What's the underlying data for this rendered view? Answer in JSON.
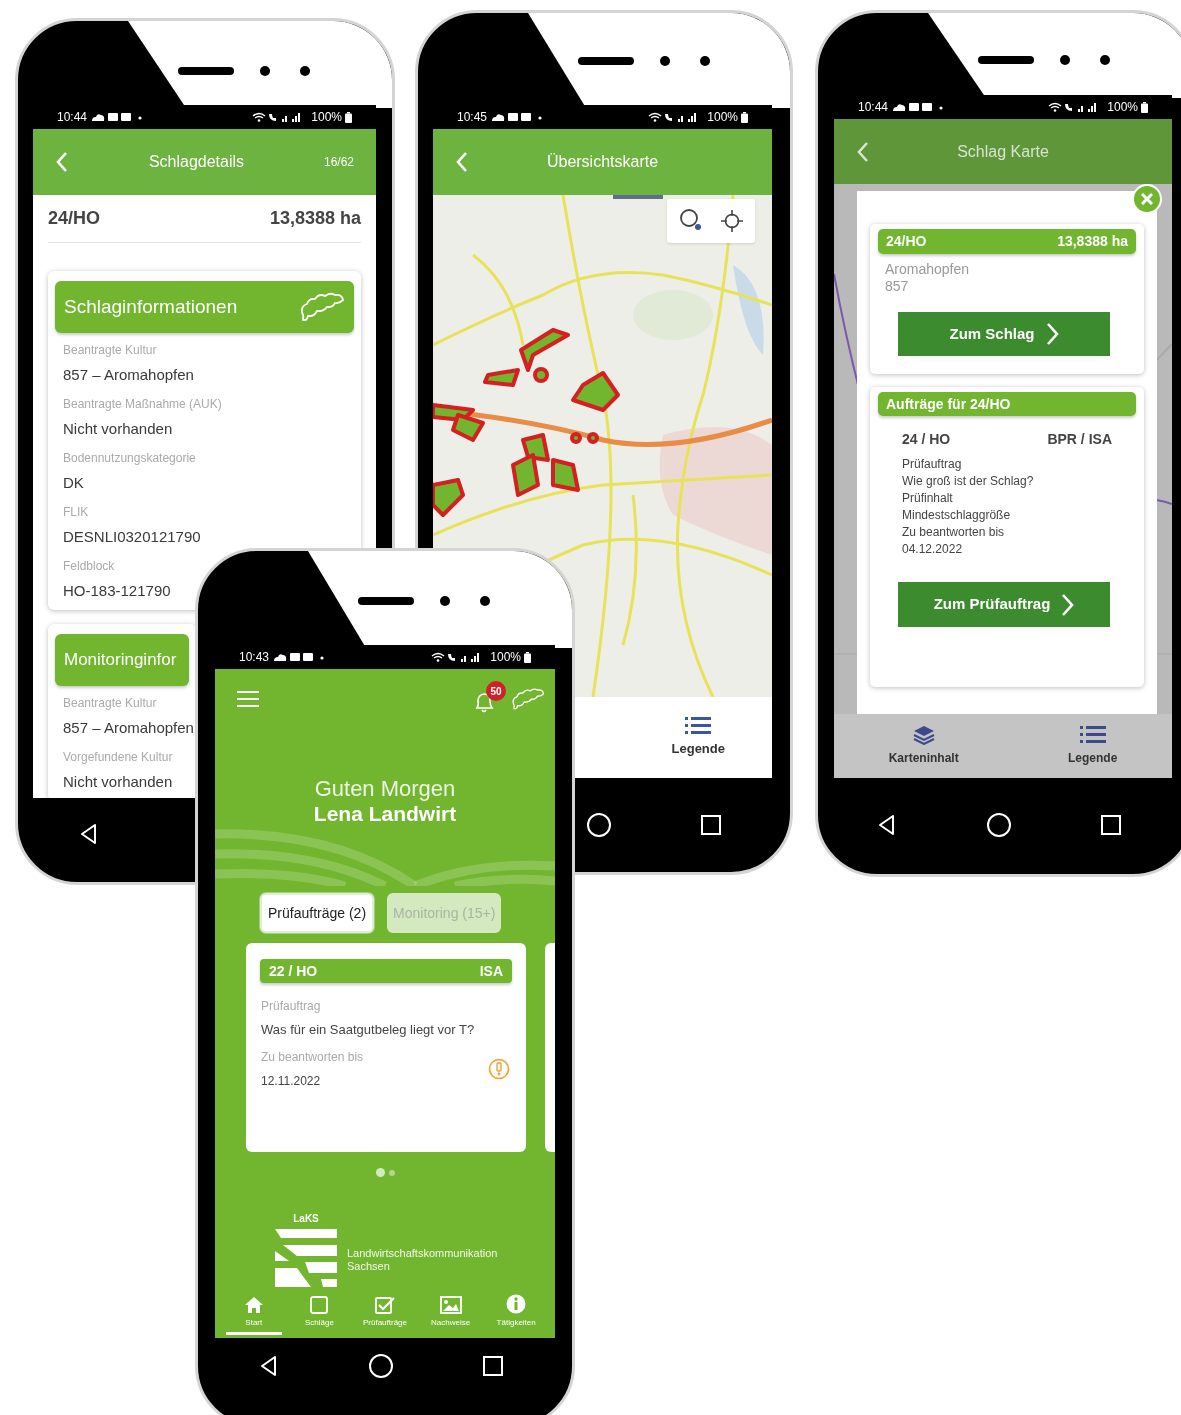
{
  "details_screen": {
    "status_bar": {
      "time": "10:44",
      "battery": "100%"
    },
    "title": "Schlagdetails",
    "counter": "16/62",
    "field_id": "24/HO",
    "area": "13,8388 ha",
    "sections": [
      {
        "title": "Schlaginformationen",
        "items": [
          {
            "label": "Beantragte Kultur",
            "value": "857 – Aromahopfen"
          },
          {
            "label": "Beantragte Maßnahme (AUK)",
            "value": "Nicht vorhanden"
          },
          {
            "label": "Bodennutzungskategorie",
            "value": "DK"
          },
          {
            "label": "FLIK",
            "value": "DESNLI0320121790"
          },
          {
            "label": "Feldblock",
            "value": "HO-183-121790"
          }
        ]
      },
      {
        "title": "Monitoringinfor",
        "items": [
          {
            "label": "Beantragte Kultur",
            "value": "857 – Aromahopfen"
          },
          {
            "label": "Vorgefundene Kultur",
            "value": "Nicht vorhanden"
          }
        ]
      }
    ]
  },
  "map_screen": {
    "status_bar": {
      "time": "10:45",
      "battery": "100%"
    },
    "title": "Übersichtskarte",
    "legend_button": "Legende"
  },
  "field_map_screen": {
    "status_bar": {
      "time": "10:44",
      "battery": "100%"
    },
    "title": "Schlag Karte",
    "field_card": {
      "field_id": "24/HO",
      "area": "13,8388 ha",
      "crop": "Aromahopfen",
      "crop_code": "857",
      "button": "Zum Schlag"
    },
    "orders_card": {
      "title": "Aufträge für 24/HO",
      "field": "24 / HO",
      "order_type": "BPR / ISA",
      "lines": [
        "Prüfauftrag",
        "Wie groß ist der Schlag?",
        "Prüfinhalt",
        "Mindestschlaggröße",
        "Zu beantworten bis",
        "04.12.2022"
      ],
      "button": "Zum Prüfauftrag"
    },
    "bottom_tabs": [
      {
        "label": "Karteninhalt"
      },
      {
        "label": "Legende"
      }
    ]
  },
  "home_screen": {
    "status_bar": {
      "time": "10:43",
      "battery": "100%"
    },
    "notification_count": "50",
    "greeting": "Guten Morgen",
    "user_name": "Lena Landwirt",
    "tabs": [
      {
        "label": "Prüfaufträge (2)",
        "selected": true
      },
      {
        "label": "Monitoring (15+)",
        "selected": false
      }
    ],
    "task_card": {
      "field": "22 / HO",
      "code": "ISA",
      "type_label": "Prüfauftrag",
      "question": "Was für ein Saatgutbeleg liegt vor T?",
      "due_label": "Zu beantworten bis",
      "due_date": "12.11.2022",
      "warning": true
    },
    "pager": [
      {
        "selected": true
      },
      {
        "selected": false
      }
    ],
    "logo": {
      "short": "LaKS",
      "name": "Landwirtschaftskommunikation Sachsen"
    },
    "nav": [
      {
        "label": "Start",
        "selected": true
      },
      {
        "label": "Schläge",
        "selected": false
      },
      {
        "label": "Prüfaufträge",
        "selected": false
      },
      {
        "label": "Nachweise",
        "selected": false
      },
      {
        "label": "Tätigkeiten",
        "selected": false
      }
    ]
  }
}
